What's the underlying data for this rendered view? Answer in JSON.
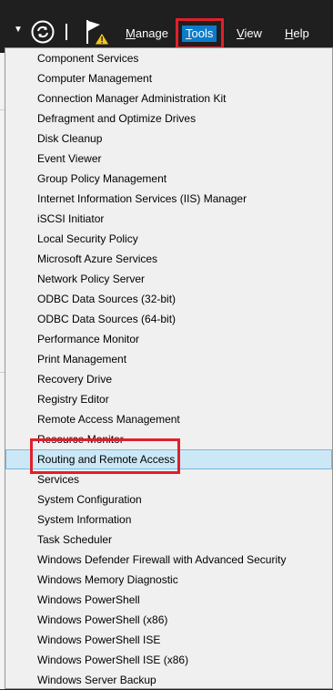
{
  "toolbar": {
    "dropdown_icon": "small-dropdown-arrow",
    "refresh_icon": "refresh-icon",
    "flag_icon": "notifications-flag-warning-icon"
  },
  "menu": {
    "manage": {
      "label": "Manage",
      "accel": "M",
      "rest": "anage"
    },
    "tools": {
      "label": "Tools",
      "accel": "T",
      "rest": "ools"
    },
    "view": {
      "label": "View",
      "accel": "V",
      "rest": "iew"
    },
    "help": {
      "label": "Help",
      "accel": "H",
      "rest": "elp"
    }
  },
  "colors": {
    "toolbar_bg": "#1f1f1f",
    "menu_selected": "#0e7ac8",
    "highlight_bg": "#cce8f6",
    "highlight_border": "#7ab9dd",
    "annotation_red": "#e0202a"
  },
  "tools_menu": {
    "items": [
      "Component Services",
      "Computer Management",
      "Connection Manager Administration Kit",
      "Defragment and Optimize Drives",
      "Disk Cleanup",
      "Event Viewer",
      "Group Policy Management",
      "Internet Information Services (IIS) Manager",
      "iSCSI Initiator",
      "Local Security Policy",
      "Microsoft Azure Services",
      "Network Policy Server",
      "ODBC Data Sources (32-bit)",
      "ODBC Data Sources (64-bit)",
      "Performance Monitor",
      "Print Management",
      "Recovery Drive",
      "Registry Editor",
      "Remote Access Management",
      "Resource Monitor",
      "Routing and Remote Access",
      "Services",
      "System Configuration",
      "System Information",
      "Task Scheduler",
      "Windows Defender Firewall with Advanced Security",
      "Windows Memory Diagnostic",
      "Windows PowerShell",
      "Windows PowerShell (x86)",
      "Windows PowerShell ISE",
      "Windows PowerShell ISE (x86)",
      "Windows Server Backup"
    ],
    "highlighted_index": 20
  }
}
